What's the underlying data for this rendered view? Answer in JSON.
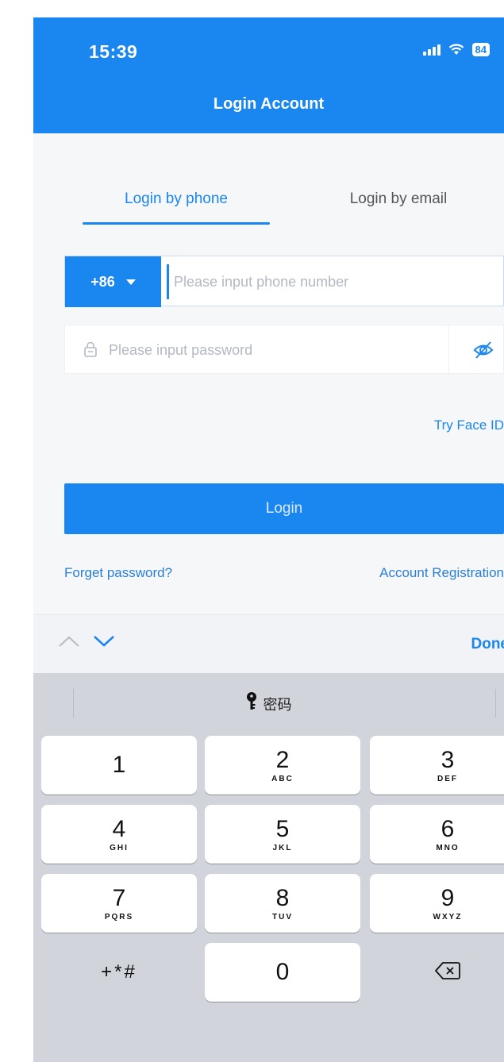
{
  "status_bar": {
    "time": "15:39",
    "battery": "84"
  },
  "header": {
    "title": "Login Account"
  },
  "tabs": [
    {
      "label": "Login by phone",
      "active": true
    },
    {
      "label": "Login by email",
      "active": false
    }
  ],
  "phone": {
    "country_code": "+86",
    "placeholder": "Please input phone number",
    "value": ""
  },
  "password": {
    "placeholder": "Please input password",
    "value": ""
  },
  "links": {
    "face_id": "Try Face ID",
    "forget_password": "Forget password?",
    "register": "Account Registration"
  },
  "login_button": "Login",
  "keyboard_toolbar": {
    "done": "Done"
  },
  "keyboard": {
    "suggestion": "密码",
    "keys": [
      {
        "digit": "1",
        "letters": ""
      },
      {
        "digit": "2",
        "letters": "ABC"
      },
      {
        "digit": "3",
        "letters": "DEF"
      },
      {
        "digit": "4",
        "letters": "GHI"
      },
      {
        "digit": "5",
        "letters": "JKL"
      },
      {
        "digit": "6",
        "letters": "MNO"
      },
      {
        "digit": "7",
        "letters": "PQRS"
      },
      {
        "digit": "8",
        "letters": "TUV"
      },
      {
        "digit": "9",
        "letters": "WXYZ"
      },
      {
        "digit": "+*#",
        "letters": ""
      },
      {
        "digit": "0",
        "letters": ""
      }
    ]
  },
  "colors": {
    "accent": "#1a86f0",
    "keyboard_bg": "#d1d4da"
  }
}
